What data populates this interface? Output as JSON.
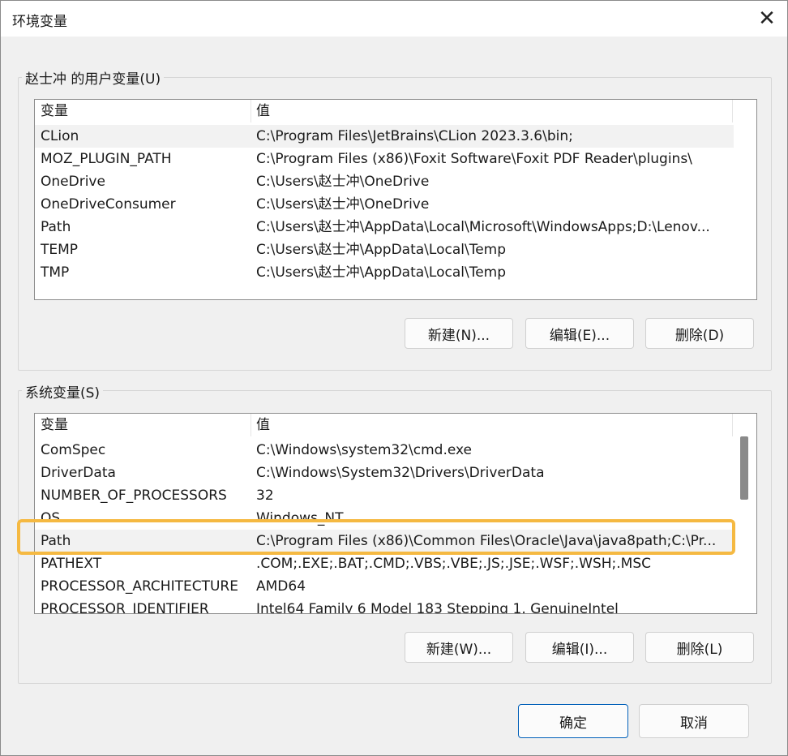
{
  "window": {
    "title": "环境变量",
    "close_glyph": "✕"
  },
  "user_vars": {
    "group_label": "赵士冲 的用户变量(U)",
    "header": {
      "name": "变量",
      "value": "值"
    },
    "rows": [
      {
        "name": "CLion",
        "value": "C:\\Program Files\\JetBrains\\CLion 2023.3.6\\bin;"
      },
      {
        "name": "MOZ_PLUGIN_PATH",
        "value": "C:\\Program Files (x86)\\Foxit Software\\Foxit PDF Reader\\plugins\\"
      },
      {
        "name": "OneDrive",
        "value": "C:\\Users\\赵士冲\\OneDrive"
      },
      {
        "name": "OneDriveConsumer",
        "value": "C:\\Users\\赵士冲\\OneDrive"
      },
      {
        "name": "Path",
        "value": "C:\\Users\\赵士冲\\AppData\\Local\\Microsoft\\WindowsApps;D:\\Lenov..."
      },
      {
        "name": "TEMP",
        "value": "C:\\Users\\赵士冲\\AppData\\Local\\Temp"
      },
      {
        "name": "TMP",
        "value": "C:\\Users\\赵士冲\\AppData\\Local\\Temp"
      }
    ],
    "buttons": {
      "new": "新建(N)...",
      "edit": "编辑(E)...",
      "delete": "删除(D)"
    }
  },
  "system_vars": {
    "group_label": "系统变量(S)",
    "header": {
      "name": "变量",
      "value": "值"
    },
    "rows": [
      {
        "name": "ComSpec",
        "value": "C:\\Windows\\system32\\cmd.exe"
      },
      {
        "name": "DriverData",
        "value": "C:\\Windows\\System32\\Drivers\\DriverData"
      },
      {
        "name": "NUMBER_OF_PROCESSORS",
        "value": "32"
      },
      {
        "name": "OS",
        "value": "Windows_NT"
      },
      {
        "name": "Path",
        "value": "C:\\Program Files (x86)\\Common Files\\Oracle\\Java\\java8path;C:\\Pr..."
      },
      {
        "name": "PATHEXT",
        "value": ".COM;.EXE;.BAT;.CMD;.VBS;.VBE;.JS;.JSE;.WSF;.WSH;.MSC"
      },
      {
        "name": "PROCESSOR_ARCHITECTURE",
        "value": "AMD64"
      },
      {
        "name": "PROCESSOR_IDENTIFIER",
        "value": "Intel64 Family 6 Model 183 Stepping 1, GenuineIntel"
      }
    ],
    "buttons": {
      "new": "新建(W)...",
      "edit": "编辑(I)...",
      "delete": "删除(L)"
    }
  },
  "footer": {
    "ok": "确定",
    "cancel": "取消"
  },
  "colors": {
    "highlight": "#f5b942",
    "primary_border": "#005fb8",
    "selected_row": "#f2f2f2"
  }
}
